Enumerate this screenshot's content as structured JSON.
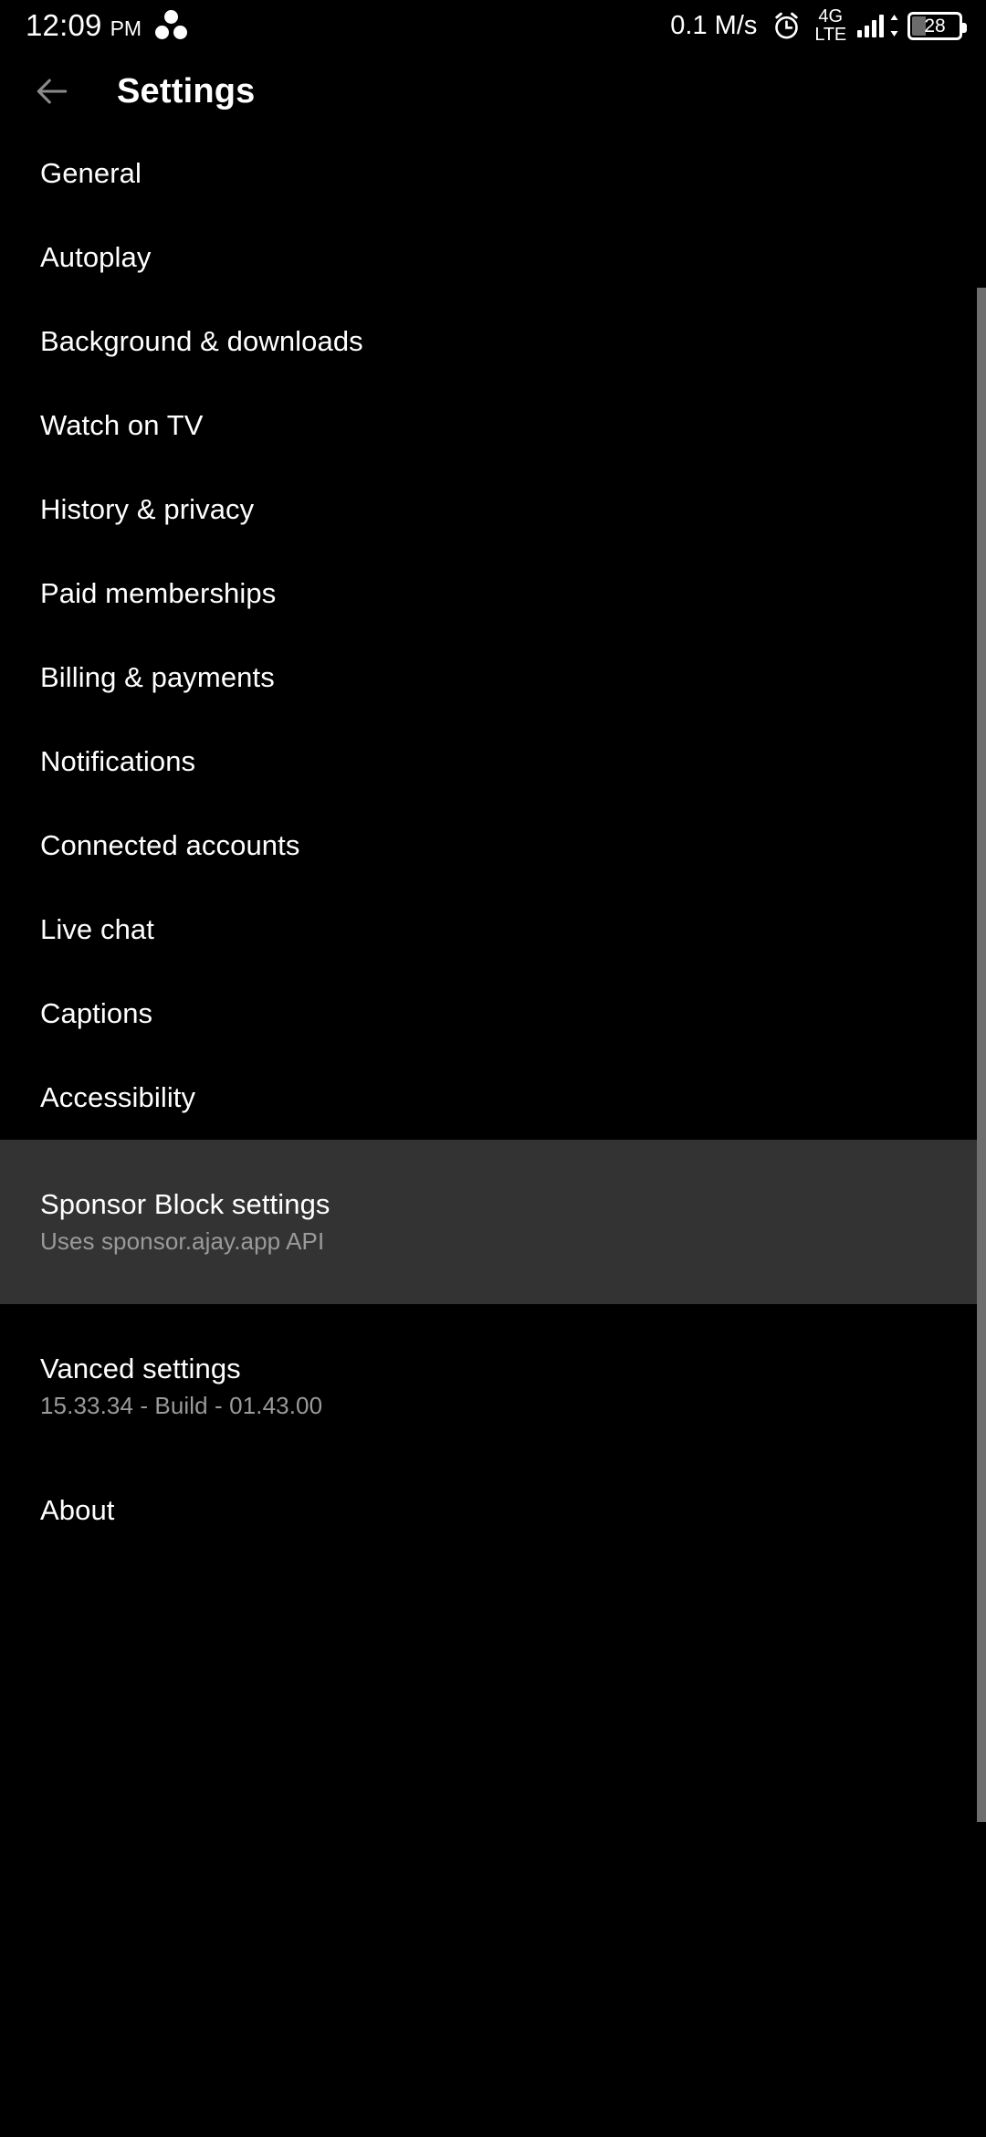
{
  "status_bar": {
    "time": "12:09",
    "am_pm": "PM",
    "notification_dots_icon": "three-dots-icon",
    "network_speed": "0.1 M/s",
    "alarm_icon": "alarm-clock-icon",
    "network_type_top": "4G",
    "network_type_bottom": "LTE",
    "signal_icon": "signal-bars-icon",
    "data_transfer_icon": "up-down-arrows-icon",
    "battery_level": "28"
  },
  "app_bar": {
    "back_icon": "arrow-left-icon",
    "title": "Settings"
  },
  "colors": {
    "background": "#000000",
    "highlight": "#333333",
    "primary_text": "#ffffff",
    "secondary_text": "#9a9a9a",
    "back_arrow": "#8a8a8a",
    "scrollbar": "#6e6e6e"
  },
  "settings": {
    "items": [
      {
        "label": "General",
        "subtitle": null,
        "highlighted": false
      },
      {
        "label": "Autoplay",
        "subtitle": null,
        "highlighted": false
      },
      {
        "label": "Background & downloads",
        "subtitle": null,
        "highlighted": false
      },
      {
        "label": "Watch on TV",
        "subtitle": null,
        "highlighted": false
      },
      {
        "label": "History & privacy",
        "subtitle": null,
        "highlighted": false
      },
      {
        "label": "Paid memberships",
        "subtitle": null,
        "highlighted": false
      },
      {
        "label": "Billing & payments",
        "subtitle": null,
        "highlighted": false
      },
      {
        "label": "Notifications",
        "subtitle": null,
        "highlighted": false
      },
      {
        "label": "Connected accounts",
        "subtitle": null,
        "highlighted": false
      },
      {
        "label": "Live chat",
        "subtitle": null,
        "highlighted": false
      },
      {
        "label": "Captions",
        "subtitle": null,
        "highlighted": false
      },
      {
        "label": "Accessibility",
        "subtitle": null,
        "highlighted": false
      },
      {
        "label": "Sponsor Block settings",
        "subtitle": "Uses sponsor.ajay.app API",
        "highlighted": true
      },
      {
        "label": "Vanced settings",
        "subtitle": "15.33.34 - Build - 01.43.00",
        "highlighted": false
      },
      {
        "label": "About",
        "subtitle": null,
        "highlighted": false
      }
    ]
  },
  "scrollbar": {
    "name": "vertical-scrollbar"
  }
}
